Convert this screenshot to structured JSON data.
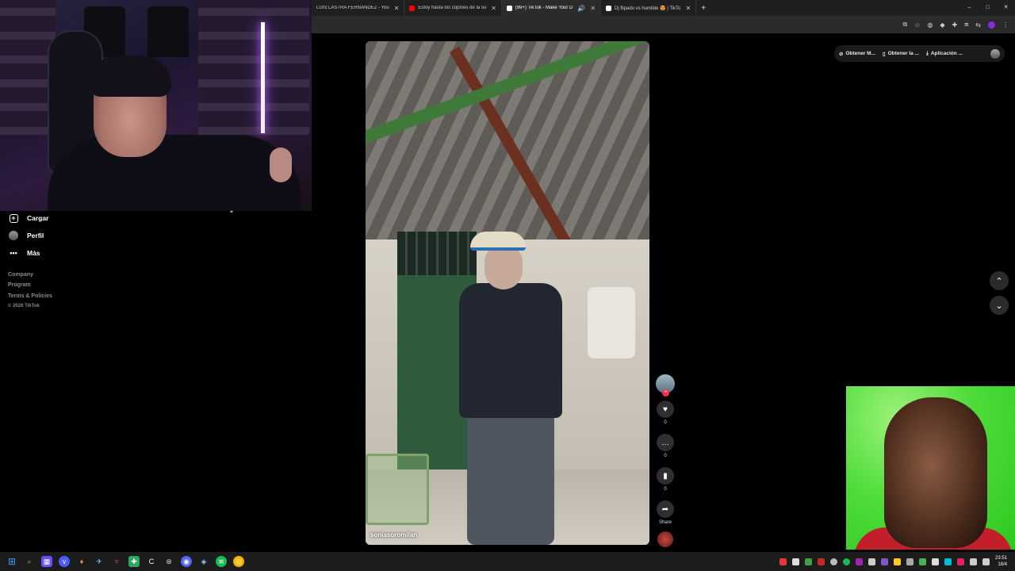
{
  "browser": {
    "tabs": [
      {
        "label": "LUIS LASTRA FERNANDEZ - You",
        "favicon_color": "#ff0000",
        "active": false
      },
      {
        "label": "Estoy hasta los cojones de la su",
        "favicon_color": "#ff0000",
        "active": false
      },
      {
        "label": "(99+) TikTok - Make Your D",
        "favicon_color": "#ffffff",
        "active": true
      },
      {
        "label": "Dj flipado vs humilde 😍 | TikTo",
        "favicon_color": "#ffffff",
        "active": false
      }
    ],
    "new_tab_glyph": "+",
    "window_controls": [
      "–",
      "□",
      "✕"
    ]
  },
  "sidebar": {
    "items": [
      {
        "label": "Cargar",
        "icon": "plus-box-icon"
      },
      {
        "label": "Perfil",
        "icon": "avatar-icon"
      },
      {
        "label": "Más",
        "icon": "more-dots-icon"
      }
    ],
    "footer": [
      "Company",
      "Program",
      "Terms & Policies"
    ],
    "copyright": "© 2026 TikTok"
  },
  "extensions": {
    "pills": [
      "Obtener M...",
      "Obtener la ...",
      "Aplicación ..."
    ]
  },
  "video": {
    "username": "soniasoromilan"
  },
  "actions": {
    "like_count": "0",
    "comment_count": "0",
    "save_count": "0",
    "share_label": "Share"
  },
  "clock": {
    "time": "23:51",
    "date": "18/4"
  },
  "colors": {
    "accent": "#fe2c55",
    "meme_green": "#4fdc3a"
  }
}
